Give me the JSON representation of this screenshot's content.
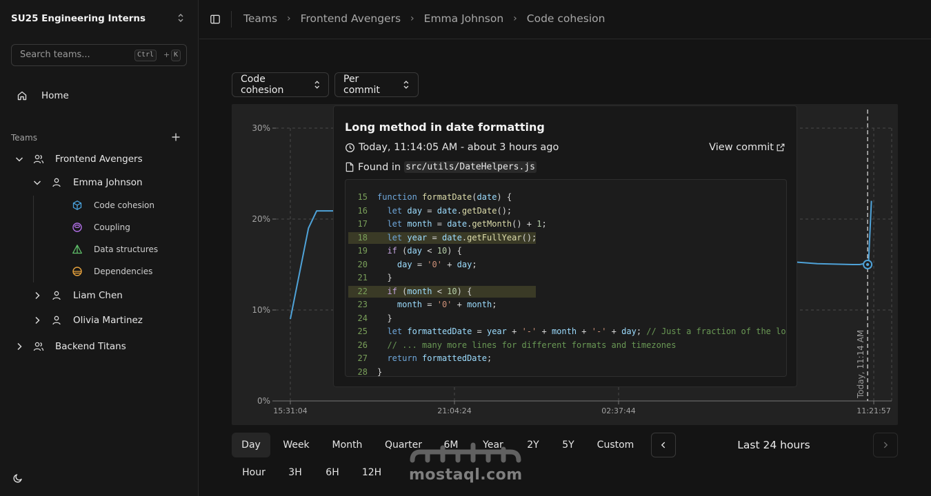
{
  "sidebar": {
    "org_name": "SU25 Engineering Interns",
    "search": {
      "placeholder": "Search teams...",
      "kbd_ctrl": "Ctrl",
      "kbd_plus": "+",
      "kbd_k": "K"
    },
    "home_label": "Home",
    "teams_label": "Teams",
    "teams": [
      {
        "label": "Frontend Avengers",
        "members": [
          {
            "label": "Emma Johnson",
            "metrics": [
              {
                "label": "Code cohesion",
                "icon": "cube-icon",
                "color": "#4aa3df"
              },
              {
                "label": "Coupling",
                "icon": "coupling-icon",
                "color": "#b06fe6"
              },
              {
                "label": "Data structures",
                "icon": "triangle-icon",
                "color": "#5fbf6a"
              },
              {
                "label": "Dependencies",
                "icon": "cylinder-icon",
                "color": "#e8a33d"
              }
            ]
          },
          {
            "label": "Liam Chen"
          },
          {
            "label": "Olivia Martinez"
          }
        ]
      },
      {
        "label": "Backend Titans"
      }
    ]
  },
  "breadcrumb": [
    "Teams",
    "Frontend Avengers",
    "Emma Johnson",
    "Code cohesion"
  ],
  "controls": {
    "metric_select": "Code cohesion",
    "granularity_select": "Per commit"
  },
  "tooltip": {
    "title": "Long method in date formatting",
    "time": "Today, 11:14:05 AM - about 3 hours ago",
    "view_commit": "View commit",
    "found_in": "Found in",
    "file_path": "src/utils/DateHelpers.js",
    "code": [
      {
        "n": "15",
        "text": "function formatDate(date) {",
        "hl": false
      },
      {
        "n": "16",
        "text": "  let day = date.getDate();",
        "hl": false
      },
      {
        "n": "17",
        "text": "  let month = date.getMonth() + 1;",
        "hl": false
      },
      {
        "n": "18",
        "text": "  let year = date.getFullYear();",
        "hl": true
      },
      {
        "n": "19",
        "text": "  if (day < 10) {",
        "hl": false
      },
      {
        "n": "20",
        "text": "    day = '0' + day;",
        "hl": false
      },
      {
        "n": "21",
        "text": "  }",
        "hl": false
      },
      {
        "n": "22",
        "text": "  if (month < 10) {",
        "hl": true
      },
      {
        "n": "23",
        "text": "    month = '0' + month;",
        "hl": false
      },
      {
        "n": "24",
        "text": "  }",
        "hl": false
      },
      {
        "n": "25",
        "text": "  let formattedDate = year + '-' + month + '-' + day; // Just a fraction of the log",
        "hl": false
      },
      {
        "n": "26",
        "text": "  // ... many more lines for different formats and timezones",
        "hl": false
      },
      {
        "n": "27",
        "text": "  return formattedDate;",
        "hl": false
      },
      {
        "n": "28",
        "text": "}",
        "hl": false
      }
    ]
  },
  "chart_data": {
    "type": "line",
    "x_tick_labels": [
      "15:31:04",
      "21:04:24",
      "02:37:44",
      "11:21:57"
    ],
    "y_tick_labels": [
      "0%",
      "10%",
      "20%",
      "30%"
    ],
    "ylim": [
      0,
      30
    ],
    "grid": true,
    "marker_label": "Today, 11:14 AM",
    "series": [
      {
        "color": "#4fa3d9",
        "x_hours": [
          0,
          0.62,
          0.9,
          1.5,
          16.3,
          18,
          19.2,
          19.45,
          19.75,
          19.85
        ],
        "y": [
          9,
          19,
          20.9,
          20.9,
          15.5,
          15.1,
          15.0,
          15.0,
          15.2,
          22
        ]
      }
    ],
    "highlight_point": {
      "x_hours": 19.72,
      "y": 15.0
    }
  },
  "time_ranges": {
    "row1": [
      "Day",
      "Week",
      "Month",
      "Quarter",
      "6M",
      "Year",
      "2Y",
      "5Y",
      "Custom"
    ],
    "row2": [
      "Hour",
      "3H",
      "6H",
      "12H"
    ],
    "active": "Day",
    "current_label": "Last 24 hours"
  },
  "watermark": {
    "text": "mostaql.com"
  }
}
